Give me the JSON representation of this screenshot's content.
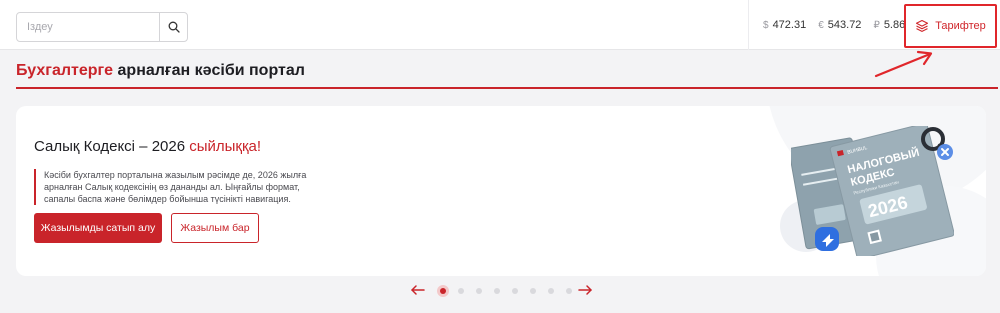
{
  "search": {
    "placeholder": "Іздеу",
    "value": "",
    "icon": "search-icon"
  },
  "rates": [
    {
      "symbol": "$",
      "value": "472.31"
    },
    {
      "symbol": "€",
      "value": "543.72"
    },
    {
      "symbol": "₽",
      "value": "5.86"
    }
  ],
  "tariff": {
    "label": "Тарифтер",
    "icon": "layers-icon",
    "highlight_color": "#e0262b"
  },
  "portal": {
    "title_accent": "Бухгалтерге",
    "title_rest": " арналған кәсіби портал"
  },
  "banner": {
    "title_prefix": "Салық Кодексі – 2026 ",
    "title_accent": "сыйлыққа!",
    "description": "Кәсіби бухгалтер порталына жазылым рәсімде де, 2026 жылға арналған Салық кодексінің өз дананды ал. Ыңғайлы формат, сапалы баспа және бөлімдер бойынша түсінікті навигация.",
    "primary_button": "Жазылымды сатып алу",
    "secondary_button": "Жазылым бар",
    "book": {
      "brand": "BUHBUL",
      "title_line1": "НАЛОГОВЫЙ",
      "title_line2": "КОДЕКС",
      "subtitle": "Республики Казахстан",
      "year": "2026"
    }
  },
  "carousel": {
    "slide_count": 8,
    "active_index": 0
  },
  "colors": {
    "brand": "#c9242a",
    "background": "#f3f3f5",
    "book": "#9eb0ba"
  }
}
